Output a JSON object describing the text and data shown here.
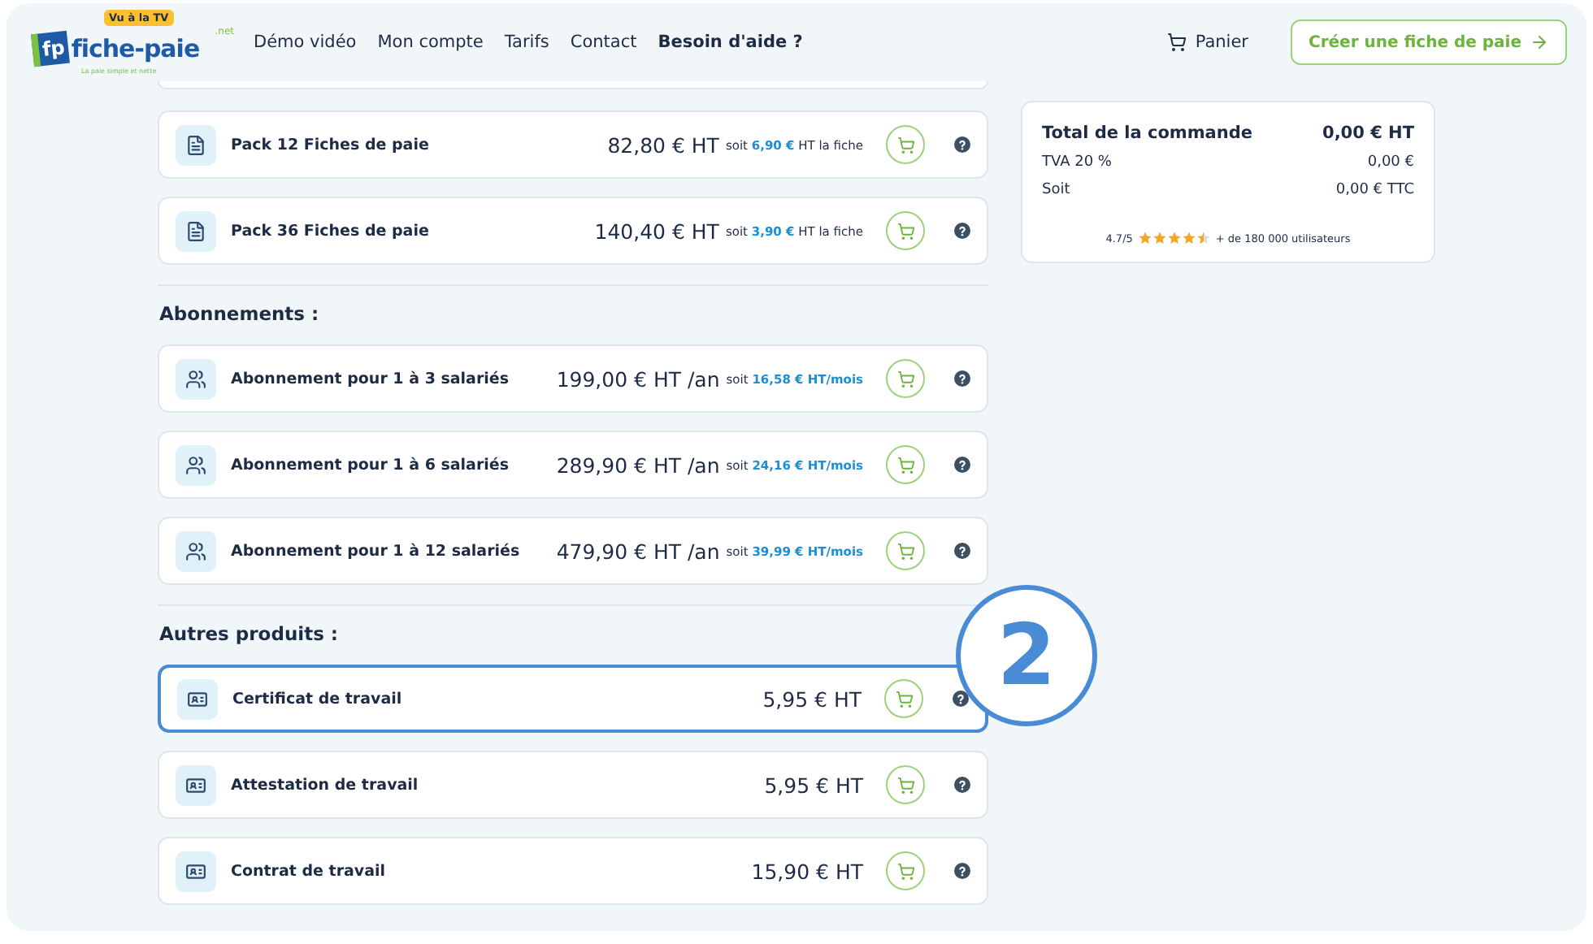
{
  "header": {
    "logo": {
      "badge": "Vu à la TV",
      "initials": "fp",
      "name": "fiche-paie",
      "tld": ".net",
      "tagline": "La paie simple et nette"
    },
    "nav": [
      "Démo vidéo",
      "Mon compte",
      "Tarifs",
      "Contact",
      "Besoin d'aide ?"
    ],
    "cart": "Panier",
    "cta": "Créer une fiche de paie"
  },
  "sections": [
    {
      "items": [
        {
          "kind": "pack",
          "name": "Pack 12 Fiches de paie",
          "price": "82,80 € HT",
          "note": {
            "prefix": "soit",
            "amount": "6,90 €",
            "suffix": "HT la fiche"
          },
          "highlighted": false
        },
        {
          "kind": "pack",
          "name": "Pack 36 Fiches de paie",
          "price": "140,40 € HT",
          "note": {
            "prefix": "soit",
            "amount": "3,90 €",
            "suffix": "HT la fiche"
          },
          "highlighted": false
        }
      ]
    },
    {
      "title": "Abonnements :",
      "items": [
        {
          "kind": "subscription",
          "name": "Abonnement pour 1 à 3 salariés",
          "price": "199,00 € HT /an",
          "note": {
            "prefix": "soit",
            "amount": "16,58 € HT/mois"
          },
          "highlighted": false
        },
        {
          "kind": "subscription",
          "name": "Abonnement pour 1 à 6 salariés",
          "price": "289,90 € HT /an",
          "note": {
            "prefix": "soit",
            "amount": "24,16 € HT/mois"
          },
          "highlighted": false
        },
        {
          "kind": "subscription",
          "name": "Abonnement pour 1 à 12 salariés",
          "price": "479,90 € HT /an",
          "note": {
            "prefix": "soit",
            "amount": "39,99 € HT/mois"
          },
          "highlighted": false
        }
      ]
    },
    {
      "title": "Autres produits :",
      "items": [
        {
          "kind": "document",
          "name": "Certificat de travail",
          "price": "5,95 € HT",
          "highlighted": true
        },
        {
          "kind": "document",
          "name": "Attestation de travail",
          "price": "5,95 € HT",
          "highlighted": false
        },
        {
          "kind": "document",
          "name": "Contrat de travail",
          "price": "15,90 € HT",
          "highlighted": false
        }
      ]
    }
  ],
  "summary": {
    "rows": [
      {
        "kind": "total",
        "label": "Total de la commande",
        "value": "0,00 € HT"
      },
      {
        "kind": "line",
        "label": "TVA 20 %",
        "value": "0,00 €"
      },
      {
        "kind": "line",
        "label": "Soit",
        "value": "0,00 € TTC"
      }
    ],
    "rating": {
      "score": "4.7/5",
      "stars": 4.5,
      "users": "+ de 180 000 utilisateurs"
    }
  },
  "callout": "2"
}
